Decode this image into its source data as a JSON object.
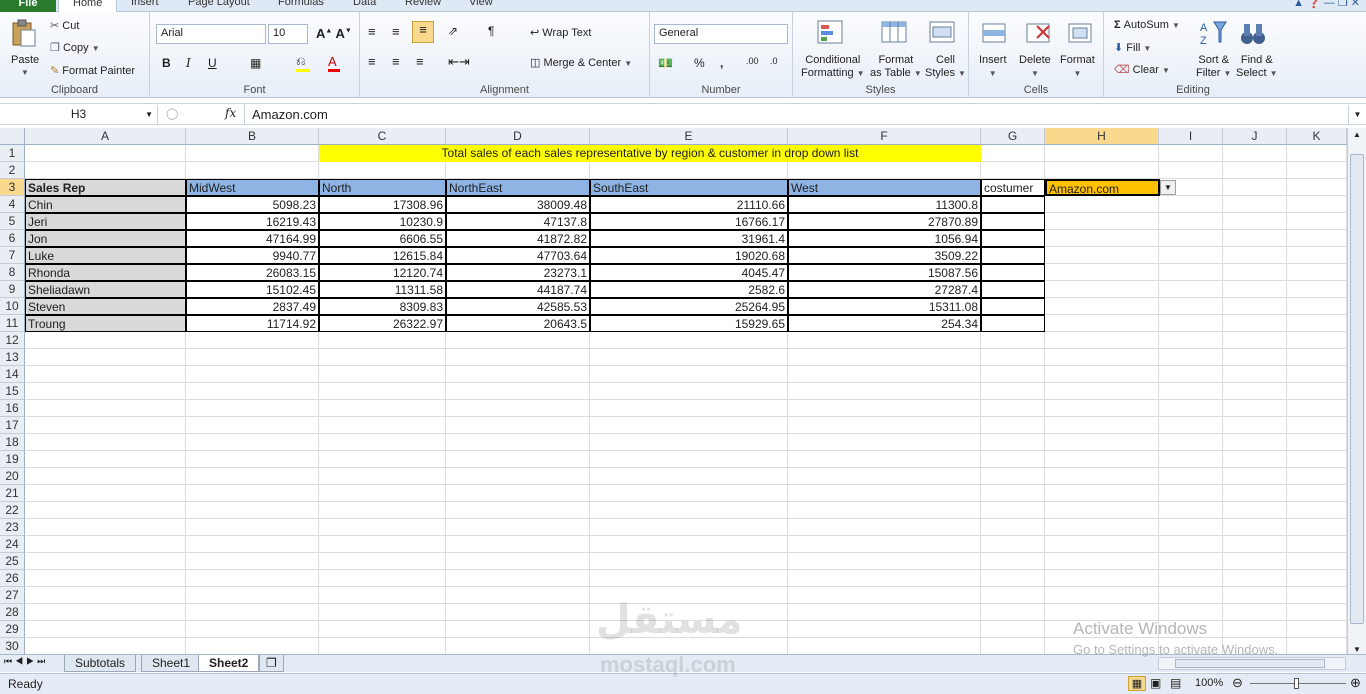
{
  "ribbon_tabs": [
    "File",
    "Home",
    "Insert",
    "Page Layout",
    "Formulas",
    "Data",
    "Review",
    "View"
  ],
  "clipboard": {
    "paste": "Paste",
    "cut": "Cut",
    "copy": "Copy",
    "format_painter": "Format Painter",
    "label": "Clipboard"
  },
  "font": {
    "name": "Arial",
    "size": "10",
    "label": "Font"
  },
  "alignment": {
    "wrap": "Wrap Text",
    "merge": "Merge & Center",
    "label": "Alignment"
  },
  "number": {
    "format": "General",
    "label": "Number"
  },
  "styles": {
    "conditional": "Conditional",
    "conditional2": "Formatting",
    "format_table": "Format",
    "format_table2": "as Table",
    "cell_styles": "Cell",
    "cell_styles2": "Styles",
    "label": "Styles"
  },
  "cells": {
    "insert": "Insert",
    "delete": "Delete",
    "format": "Format",
    "label": "Cells"
  },
  "editing": {
    "autosum": "AutoSum",
    "fill": "Fill",
    "clear": "Clear",
    "sort": "Sort &",
    "sort2": "Filter",
    "find": "Find &",
    "find2": "Select",
    "label": "Editing"
  },
  "formula_bar": {
    "name_box": "H3",
    "fx": "fx",
    "content": "Amazon.com"
  },
  "columns": [
    "A",
    "B",
    "C",
    "D",
    "E",
    "F",
    "G",
    "H",
    "I",
    "J",
    "K"
  ],
  "rows": [
    "1",
    "2",
    "3",
    "4",
    "5",
    "6",
    "7",
    "8",
    "9",
    "10",
    "11",
    "12",
    "13",
    "14",
    "15",
    "16",
    "17",
    "18",
    "19",
    "20",
    "21",
    "22",
    "23",
    "24",
    "25",
    "26",
    "27",
    "28",
    "29",
    "30"
  ],
  "sheet": {
    "title": "Total sales of each sales representative by region & customer in drop down list",
    "header": [
      "Sales Rep",
      "MidWest",
      "North",
      "NorthEast",
      "SouthEast",
      "West",
      "costumer"
    ],
    "selected_value": "Amazon.com",
    "data": [
      [
        "Chin",
        "5098.23",
        "17308.96",
        "38009.48",
        "21110.66",
        "11300.8"
      ],
      [
        "Jeri",
        "16219.43",
        "10230.9",
        "47137.8",
        "16766.17",
        "27870.89"
      ],
      [
        "Jon",
        "47164.99",
        "6606.55",
        "41872.82",
        "31961.4",
        "1056.94"
      ],
      [
        "Luke",
        "9940.77",
        "12615.84",
        "47703.64",
        "19020.68",
        "3509.22"
      ],
      [
        "Rhonda",
        "26083.15",
        "12120.74",
        "23273.1",
        "4045.47",
        "15087.56"
      ],
      [
        "Sheliadawn",
        "15102.45",
        "11311.58",
        "44187.74",
        "2582.6",
        "27287.4"
      ],
      [
        "Steven",
        "2837.49",
        "8309.83",
        "42585.53",
        "25264.95",
        "15311.08"
      ],
      [
        "Troung",
        "11714.92",
        "26322.97",
        "20643.5",
        "15929.65",
        "254.34"
      ]
    ]
  },
  "sheet_tabs": [
    "Subtotals",
    "Sheet1",
    "Sheet2"
  ],
  "status": {
    "ready": "Ready",
    "zoom": "100%"
  },
  "watermark": {
    "line1": "مستقل",
    "line2": "mostaql.com"
  },
  "activate": {
    "line1": "Activate Windows",
    "line2": "Go to Settings to activate Windows."
  },
  "colors": {
    "title_fill": "#ffff00",
    "header_fill": "#8db4e2",
    "selected_fill": "#ffc000",
    "rep_fill": "#d9d9d9"
  }
}
